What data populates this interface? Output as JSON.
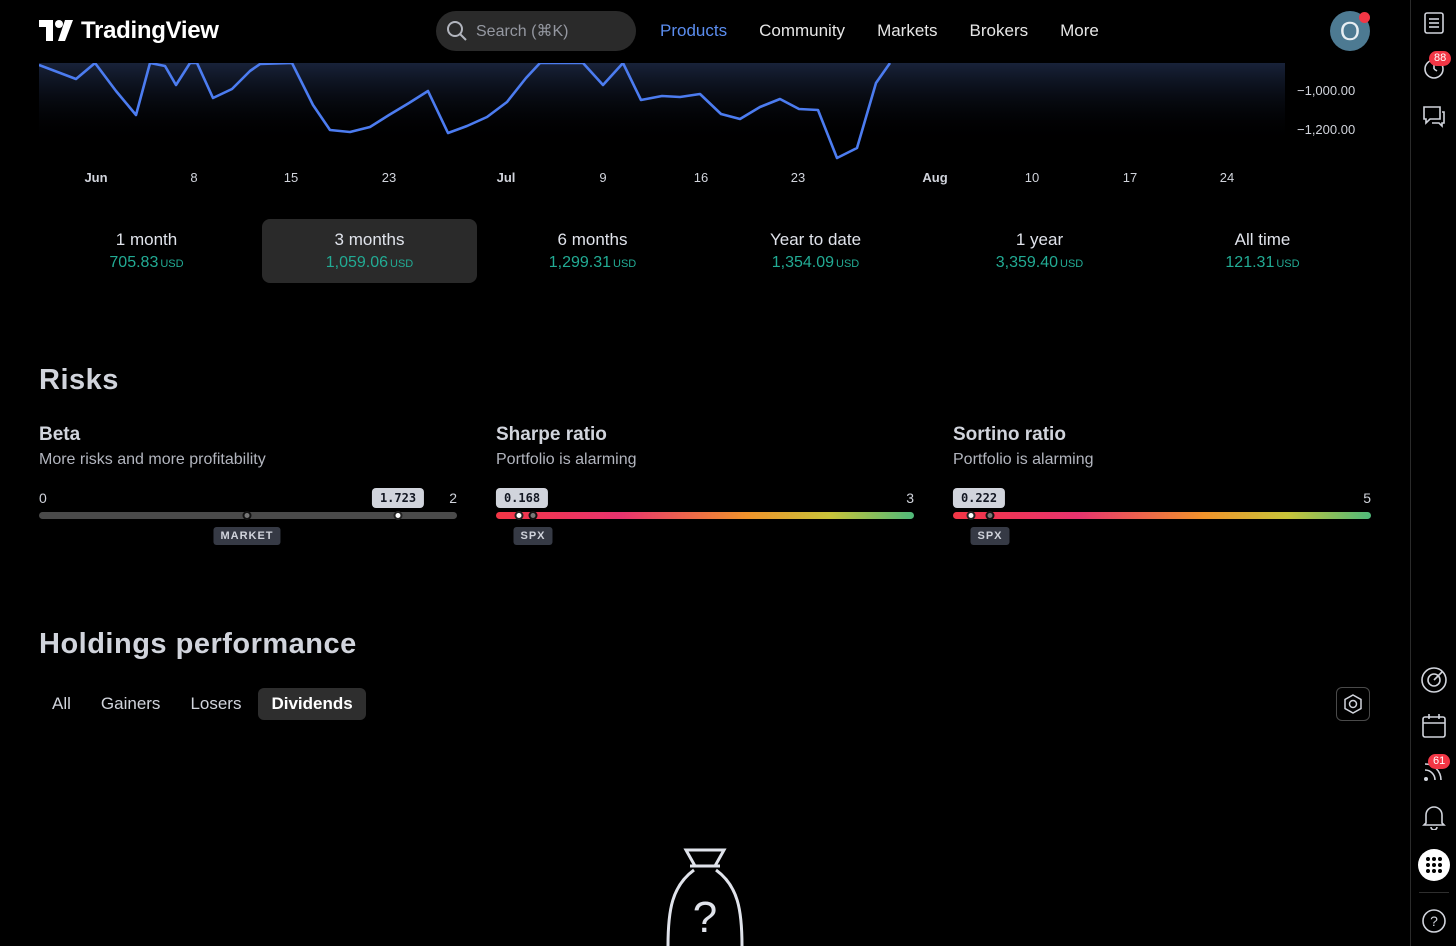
{
  "header": {
    "brand": "TradingView",
    "search_placeholder": "Search (⌘K)",
    "nav": [
      "Products",
      "Community",
      "Markets",
      "Brokers",
      "More"
    ],
    "avatar_letter": "O"
  },
  "sidebar": {
    "badge_top": "88",
    "badge_bottom": "61"
  },
  "chart": {
    "y_labels": [
      "−1,000.00",
      "−1,200.00"
    ],
    "x_labels": [
      "Jun",
      "8",
      "15",
      "23",
      "Jul",
      "9",
      "16",
      "23",
      "Aug",
      "10",
      "17",
      "24"
    ],
    "line_color": "#4c7cf0"
  },
  "periods": [
    {
      "label": "1 month",
      "value": "705.83",
      "currency": "USD"
    },
    {
      "label": "3 months",
      "value": "1,059.06",
      "currency": "USD"
    },
    {
      "label": "6 months",
      "value": "1,299.31",
      "currency": "USD"
    },
    {
      "label": "Year to date",
      "value": "1,354.09",
      "currency": "USD"
    },
    {
      "label": "1 year",
      "value": "3,359.40",
      "currency": "USD"
    },
    {
      "label": "All time",
      "value": "121.31",
      "currency": "USD"
    }
  ],
  "risks": {
    "heading": "Risks",
    "beta": {
      "title": "Beta",
      "subtitle": "More risks and more profitability",
      "min": "0",
      "max": "2",
      "value": "1.723",
      "benchmark": "MARKET"
    },
    "sharpe": {
      "title": "Sharpe ratio",
      "subtitle": "Portfolio is alarming",
      "max": "3",
      "value": "0.168",
      "benchmark": "SPX"
    },
    "sortino": {
      "title": "Sortino ratio",
      "subtitle": "Portfolio is alarming",
      "max": "5",
      "value": "0.222",
      "benchmark": "SPX"
    }
  },
  "holdings": {
    "heading": "Holdings performance",
    "tabs": [
      "All",
      "Gainers",
      "Losers",
      "Dividends"
    ],
    "selected_tab": "Dividends"
  },
  "colors": {
    "accent": "#5b8def",
    "positive": "#22ab94",
    "badge": "#f23645"
  }
}
